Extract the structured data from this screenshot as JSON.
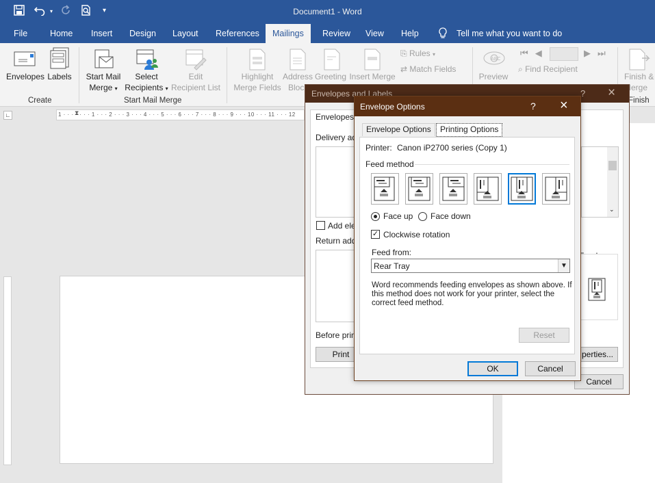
{
  "window": {
    "title": "Document1  -  Word"
  },
  "qat": {
    "save_icon": "save-icon",
    "undo_icon": "undo-icon",
    "redo_icon": "redo-icon",
    "preview_icon": "print-preview-icon",
    "customize_icon": "customize-qat-icon"
  },
  "tabs": [
    "File",
    "Home",
    "Insert",
    "Design",
    "Layout",
    "References",
    "Mailings",
    "Review",
    "View",
    "Help"
  ],
  "tell_me": "Tell me what you want to do",
  "ribbon": {
    "create": {
      "envelopes": "Envelopes",
      "labels": "Labels",
      "group": "Create"
    },
    "start_mail_merge": {
      "start_l1": "Start Mail",
      "start_l2": "Merge",
      "select_l1": "Select",
      "select_l2": "Recipients",
      "edit_l1": "Edit",
      "edit_l2": "Recipient List",
      "group": "Start Mail Merge"
    },
    "write_insert": {
      "highlight_l1": "Highlight",
      "highlight_l2": "Merge Fields",
      "address_l1": "Address",
      "address_l2": "Block",
      "greeting_l1": "Greeting",
      "insert_l1": "Insert Merge",
      "rules": "Rules",
      "match_fields": "Match Fields"
    },
    "preview": {
      "preview": "Preview",
      "find_recipient": "Find Recipient"
    },
    "finish": {
      "l1": "Finish &",
      "l2": "Merge",
      "group": "Finish"
    }
  },
  "ruler": {
    "marks": "1 · · · · · · · 1 · · · 2 · · · 3 · · · 4 · · · 5 · · · 6 · · · 7 · · · 8 · · · 9 · · · 10 · · · 11 · · · 12"
  },
  "back_dialog": {
    "title": "Envelopes and Labels",
    "tab_envelopes": "Envelopes",
    "delivery": "Delivery ad",
    "add_electronic": "Add ele",
    "return_address": "Return add",
    "before_printing": "Before prin",
    "print": "Print",
    "feed": "Feed",
    "properties": "perties...",
    "cancel": "Cancel",
    "help": "?"
  },
  "dialog": {
    "title": "Envelope Options",
    "help": "?",
    "tabs": [
      "Envelope Options",
      "Printing Options"
    ],
    "printer_label": "Printer:",
    "printer_value": "Canon iP2700 series (Copy 1)",
    "feed_method": "Feed method",
    "feed_options": [
      "feed-horizontal-left",
      "feed-horizontal-center",
      "feed-horizontal-right",
      "feed-vertical-left",
      "feed-vertical-center",
      "feed-vertical-right"
    ],
    "selected_feed": "feed-vertical-center",
    "face_up": "Face up",
    "face_down": "Face down",
    "face_selected": "Face up",
    "clockwise": "Clockwise rotation",
    "clockwise_checked": true,
    "feed_from_label": "Feed from:",
    "feed_from_value": "Rear Tray",
    "note": "Word recommends feeding envelopes as shown above. If this method does not work for your printer, select the correct feed method.",
    "reset": "Reset",
    "ok": "OK",
    "cancel": "Cancel"
  },
  "colors": {
    "word_blue": "#2b579a",
    "dialog_title": "#5b2f12",
    "focus_blue": "#0078d7"
  }
}
